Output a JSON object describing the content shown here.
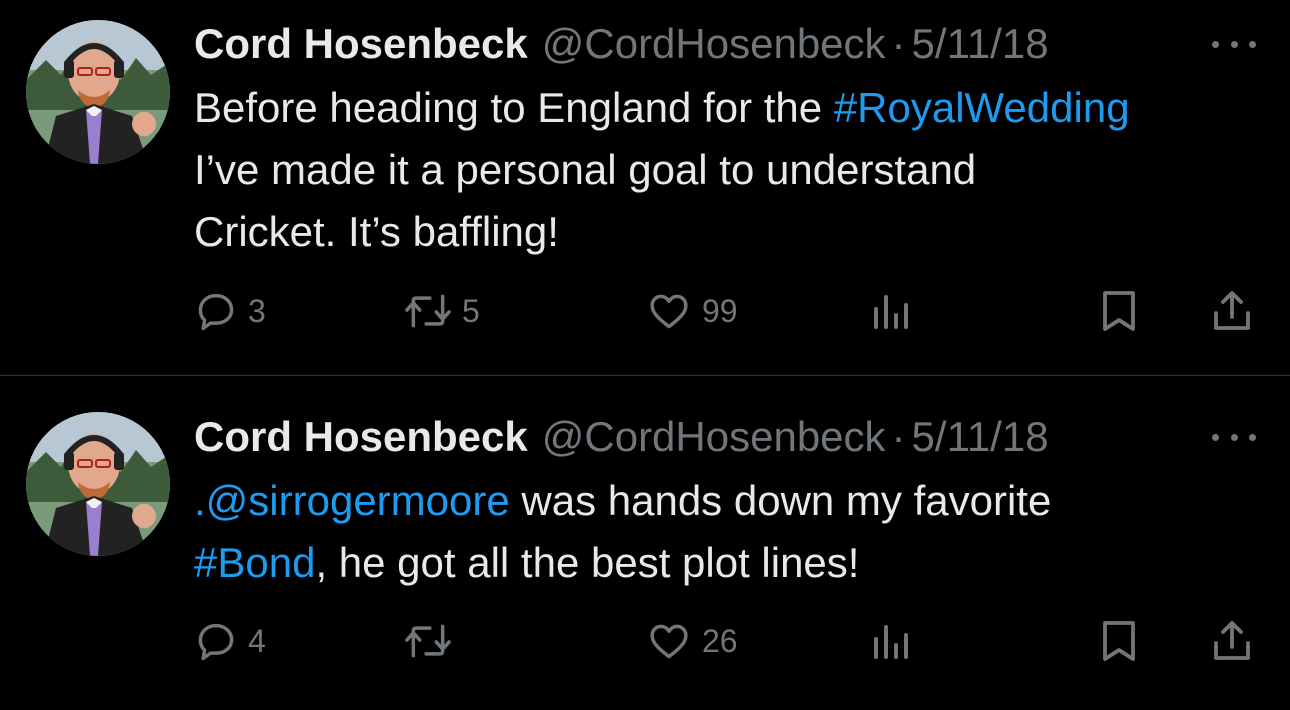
{
  "colors": {
    "background": "#000000",
    "primary_text": "#e7e9ea",
    "secondary_text": "#71767b",
    "link": "#1d9bf0",
    "divider": "#2f3336"
  },
  "tweets": [
    {
      "author_name": "Cord Hosenbeck",
      "author_handle": "@CordHosenbeck",
      "separator": "·",
      "date": "5/11/18",
      "text_lines": [
        [
          {
            "text": "Before heading to England for the ",
            "link": false
          },
          {
            "text": "#RoyalWedding",
            "link": true
          }
        ],
        [
          {
            "text": "I’ve made it a personal goal to understand",
            "link": false
          }
        ],
        [
          {
            "text": "Cricket. It’s baffling!",
            "link": false
          }
        ]
      ],
      "actions": {
        "reply_count": "3",
        "retweet_count": "5",
        "like_count": "99"
      },
      "icons": [
        "avatar",
        "more-options-icon",
        "reply-icon",
        "retweet-icon",
        "like-icon",
        "views-icon",
        "bookmark-icon",
        "share-icon"
      ]
    },
    {
      "author_name": "Cord Hosenbeck",
      "author_handle": "@CordHosenbeck",
      "separator": "·",
      "date": "5/11/18",
      "text_lines": [
        [
          {
            "text": ".@sirrogermoore",
            "link": true
          },
          {
            "text": " was hands down my favorite",
            "link": false
          }
        ],
        [
          {
            "text": "#Bond",
            "link": true
          },
          {
            "text": ", he got all the best plot lines!",
            "link": false
          }
        ]
      ],
      "actions": {
        "reply_count": "4",
        "retweet_count": "",
        "like_count": "26"
      },
      "icons": [
        "avatar",
        "more-options-icon",
        "reply-icon",
        "retweet-icon",
        "like-icon",
        "views-icon",
        "bookmark-icon",
        "share-icon"
      ]
    }
  ]
}
